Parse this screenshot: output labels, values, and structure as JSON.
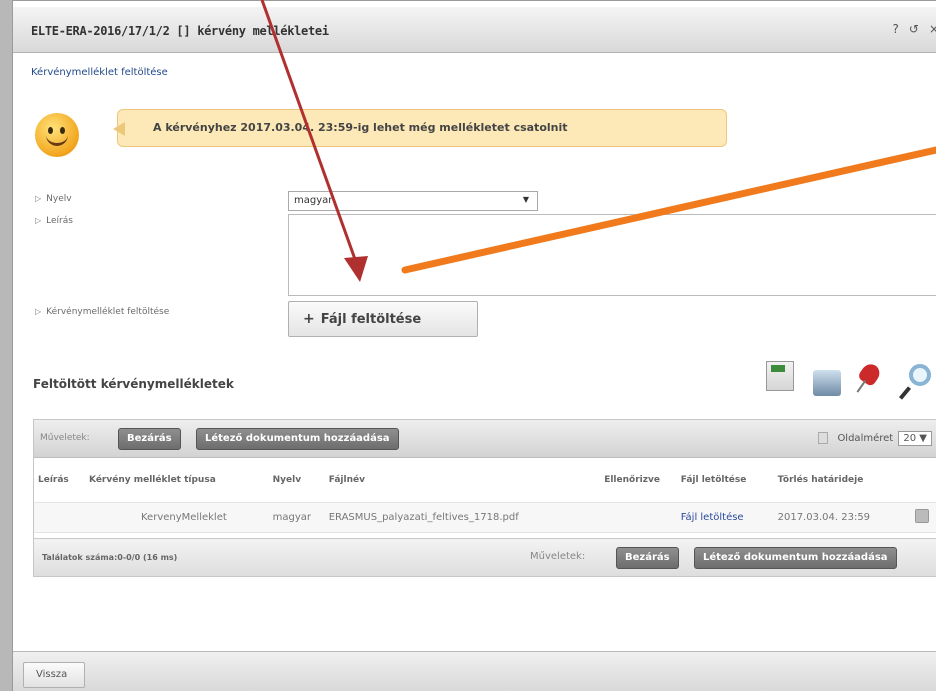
{
  "window": {
    "title": "ELTE-ERA-2016/17/1/2 [] kérvény mellékletei",
    "help_icon": "?",
    "refresh_icon": "↺",
    "close_icon": "×"
  },
  "subtitle": "Kérvénymelléklet feltöltése",
  "notice": "A kérvényhez 2017.03.04. 23:59-ig lehet még mellékletet csatolnit",
  "form": {
    "language_label": "Nyelv",
    "language_value": "magyar",
    "description_label": "Leírás",
    "upload_label": "Kérvénymelléklet feltöltése",
    "upload_button": "Fájl feltöltése"
  },
  "section_title": "Feltöltött kérvénymellékletek",
  "toolbar_icons": [
    "excel-export-icon",
    "print-icon",
    "pin-icon",
    "search-icon"
  ],
  "grid": {
    "actions_label": "Műveletek:",
    "close_button": "Bezárás",
    "add_existing_button": "Létező dokumentum hozzáadása",
    "page_size_label": "Oldalméret",
    "page_size_value": "20",
    "columns": [
      "Leírás",
      "Kérvény melléklet típusa",
      "Nyelv",
      "Fájlnév",
      "Ellenőrizve",
      "Fájl letöltése",
      "Törlés határideje"
    ],
    "rows": [
      {
        "description": "",
        "type": "KervenyMelleklet",
        "language": "magyar",
        "filename": "ERASMUS_palyazati_feltives_1718.pdf",
        "checked": "",
        "download": "Fájl letöltése",
        "deadline": "2017.03.04. 23:59"
      }
    ],
    "result_count": "Találatok száma:0-0/0 (16 ms)",
    "footer_actions_label": "Műveletek:",
    "footer_close_button": "Bezárás",
    "footer_add_button": "Létező dokumentum hozzáadása"
  },
  "back_button": "Vissza",
  "annotation_colors": {
    "red_arrow": "#b03030",
    "orange_line": "#f07a1c"
  }
}
